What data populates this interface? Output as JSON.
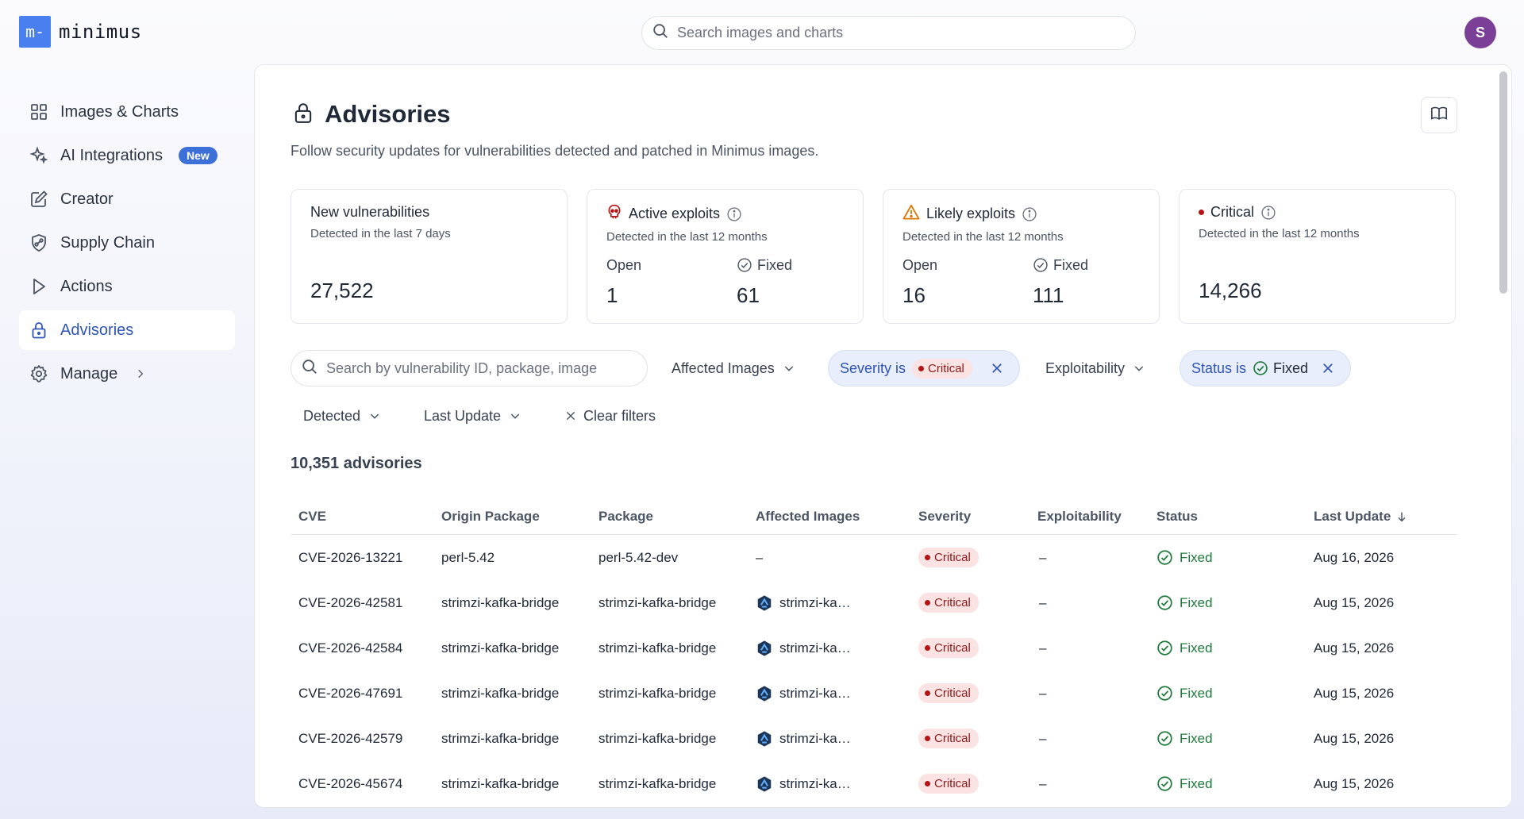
{
  "app": {
    "logo_mark": "m-",
    "logo_text": "minimus"
  },
  "topbar": {
    "search_placeholder": "Search images and charts",
    "avatar_initial": "S"
  },
  "sidebar": {
    "items": [
      {
        "label": "Images & Charts",
        "icon": "grid-icon"
      },
      {
        "label": "AI Integrations",
        "icon": "sparkle-icon",
        "badge": "New"
      },
      {
        "label": "Creator",
        "icon": "pencil-icon"
      },
      {
        "label": "Supply Chain",
        "icon": "shield-link-icon"
      },
      {
        "label": "Actions",
        "icon": "play-icon"
      },
      {
        "label": "Advisories",
        "icon": "lock-icon",
        "active": true
      },
      {
        "label": "Manage",
        "icon": "gear-icon"
      }
    ]
  },
  "page": {
    "title": "Advisories",
    "description": "Follow security updates for vulnerabilities detected and patched in Minimus images."
  },
  "cards": {
    "new_vulns": {
      "title": "New vulnerabilities",
      "subtitle": "Detected in the last 7 days",
      "value": "27,522"
    },
    "active_exploits": {
      "title": "Active exploits",
      "subtitle": "Detected in the last 12 months",
      "open_label": "Open",
      "open_value": "1",
      "fixed_label": "Fixed",
      "fixed_value": "61"
    },
    "likely_exploits": {
      "title": "Likely exploits",
      "subtitle": "Detected in the last 12 months",
      "open_label": "Open",
      "open_value": "16",
      "fixed_label": "Fixed",
      "fixed_value": "111"
    },
    "critical": {
      "title": "Critical",
      "subtitle": "Detected in the last 12 months",
      "value": "14,266"
    }
  },
  "filters": {
    "search_placeholder": "Search by vulnerability ID, package, image",
    "affected_images": "Affected Images",
    "severity_chip": {
      "prefix": "Severity is",
      "value": "Critical"
    },
    "exploitability": "Exploitability",
    "status_chip": {
      "prefix": "Status is",
      "value": "Fixed"
    },
    "detected": "Detected",
    "last_update": "Last Update",
    "clear": "Clear filters"
  },
  "results": {
    "count": "10,351 advisories"
  },
  "table": {
    "columns": [
      "CVE",
      "Origin Package",
      "Package",
      "Affected Images",
      "Severity",
      "Exploitability",
      "Status",
      "Last Update"
    ],
    "rows": [
      {
        "cve": "CVE-2026-13221",
        "origin": "perl-5.42",
        "package": "perl-5.42-dev",
        "image": "–",
        "severity": "Critical",
        "exploitability": "–",
        "status": "Fixed",
        "updated": "Aug 16, 2026"
      },
      {
        "cve": "CVE-2026-42581",
        "origin": "strimzi-kafka-bridge",
        "package": "strimzi-kafka-bridge",
        "image": "strimzi-kafka-bridge",
        "severity": "Critical",
        "exploitability": "–",
        "status": "Fixed",
        "updated": "Aug 15, 2026"
      },
      {
        "cve": "CVE-2026-42584",
        "origin": "strimzi-kafka-bridge",
        "package": "strimzi-kafka-bridge",
        "image": "strimzi-kafka-bridge",
        "severity": "Critical",
        "exploitability": "–",
        "status": "Fixed",
        "updated": "Aug 15, 2026"
      },
      {
        "cve": "CVE-2026-47691",
        "origin": "strimzi-kafka-bridge",
        "package": "strimzi-kafka-bridge",
        "image": "strimzi-kafka-bridge",
        "severity": "Critical",
        "exploitability": "–",
        "status": "Fixed",
        "updated": "Aug 15, 2026"
      },
      {
        "cve": "CVE-2026-42579",
        "origin": "strimzi-kafka-bridge",
        "package": "strimzi-kafka-bridge",
        "image": "strimzi-kafka-bridge",
        "severity": "Critical",
        "exploitability": "–",
        "status": "Fixed",
        "updated": "Aug 15, 2026"
      },
      {
        "cve": "CVE-2026-45674",
        "origin": "strimzi-kafka-bridge",
        "package": "strimzi-kafka-bridge",
        "image": "strimzi-kafka-bridge",
        "severity": "Critical",
        "exploitability": "–",
        "status": "Fixed",
        "updated": "Aug 15, 2026"
      }
    ]
  },
  "colors": {
    "accent": "#2f55b8",
    "brand": "#4a7ff0",
    "critical": "#b31515",
    "fixed": "#1e7a3a",
    "avatar": "#7b3f98"
  }
}
